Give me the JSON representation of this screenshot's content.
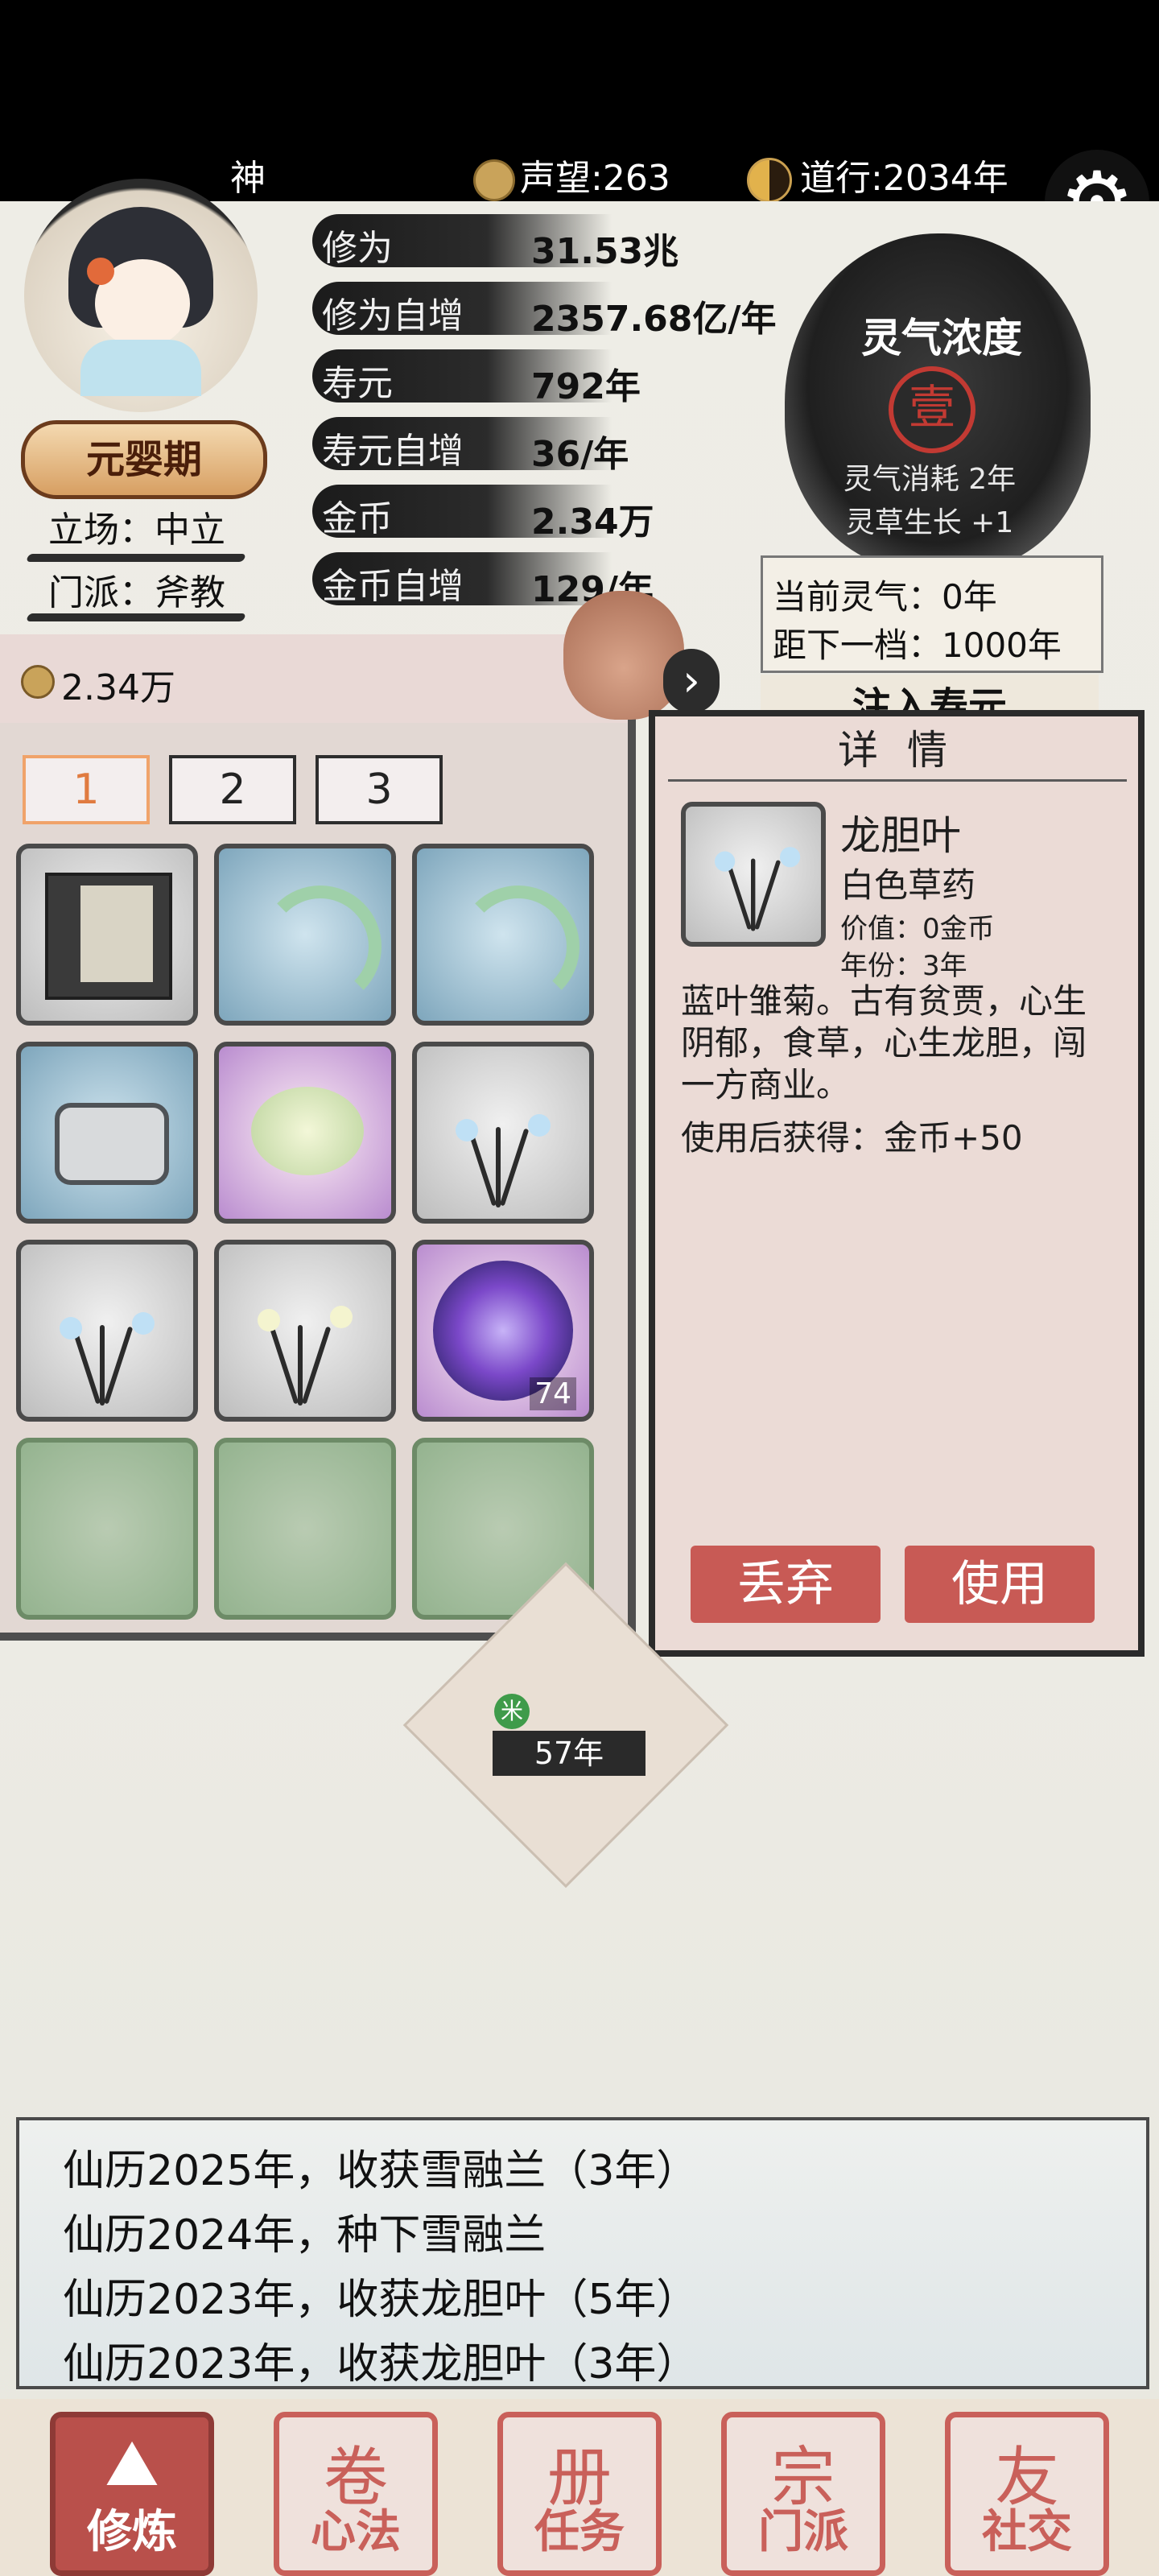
{
  "top": {
    "name": "神",
    "prestige": "声望:263",
    "dao": "道行:2034年"
  },
  "player": {
    "realm": "元婴期",
    "stance": "立场：中立",
    "sect": "门派：斧教"
  },
  "stats": [
    {
      "label": "修为",
      "value": "31.53兆"
    },
    {
      "label": "修为自增",
      "value": "2357.68亿/年"
    },
    {
      "label": "寿元",
      "value": "792年"
    },
    {
      "label": "寿元自增",
      "value": "36/年"
    },
    {
      "label": "金币",
      "value": "2.34万"
    },
    {
      "label": "金币自增",
      "value": "129/年"
    }
  ],
  "spirit": {
    "title": "灵气浓度",
    "level": "壹",
    "consume": "灵气消耗 2年",
    "growth": "灵草生长 +1",
    "current": "当前灵气：0年",
    "next": "距下一档：1000年",
    "inject": "注入寿元"
  },
  "inventory": {
    "gold": "2.34万",
    "tabs": [
      "1",
      "2",
      "3"
    ],
    "active_tab": "1",
    "stack_count": "74"
  },
  "detail": {
    "title": "详 情",
    "name": "龙胆叶",
    "type": "白色草药",
    "value": "价值：0金币",
    "age": "年份：3年",
    "description": "蓝叶雏菊。古有贫贾，心生阴郁，食草，心生龙胆，闯一方商业。",
    "effect": "使用后获得：金币+50",
    "discard": "丢弃",
    "use": "使用"
  },
  "plot": {
    "age": "57年",
    "icon": "米"
  },
  "log": [
    "仙历2025年，收获雪融兰（3年）",
    "仙历2024年，种下雪融兰",
    "仙历2023年，收获龙胆叶（5年）",
    "仙历2023年，收获龙胆叶（3年）"
  ],
  "nav": [
    {
      "label": "修炼",
      "glyph": "⛰"
    },
    {
      "label": "心法",
      "glyph": "卷"
    },
    {
      "label": "任务",
      "glyph": "册"
    },
    {
      "label": "门派",
      "glyph": "宗"
    },
    {
      "label": "社交",
      "glyph": "友"
    }
  ],
  "colors": {
    "accent": "#c85a55",
    "tab_active": "#e07b40",
    "ink": "#1f1f1f"
  }
}
